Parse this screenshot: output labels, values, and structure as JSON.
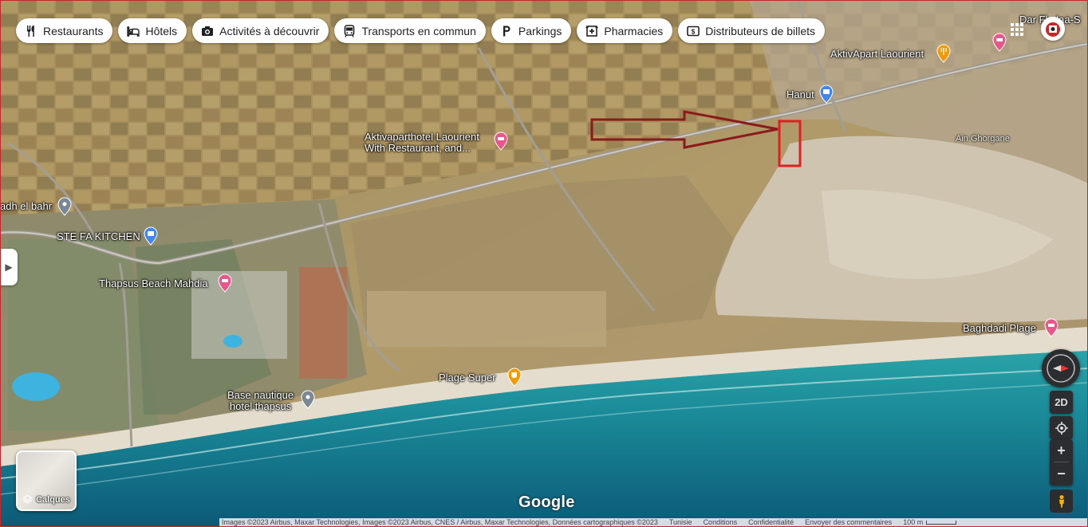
{
  "categories": [
    {
      "label": "Restaurants",
      "icon": "fork-knife-icon"
    },
    {
      "label": "Hôtels",
      "icon": "bed-icon"
    },
    {
      "label": "Activités à découvrir",
      "icon": "camera-icon"
    },
    {
      "label": "Transports en commun",
      "icon": "bus-icon"
    },
    {
      "label": "Parkings",
      "icon": "parking-icon"
    },
    {
      "label": "Pharmacies",
      "icon": "pharmacy-icon"
    },
    {
      "label": "Distributeurs de billets",
      "icon": "cash-icon"
    }
  ],
  "places": {
    "top_right": "Dar Fl...laa-S",
    "aktivapart": "AktivApart Laourient",
    "hanut": "Hanut",
    "hotel_line1": "Aktivaparthotel Laourient",
    "hotel_line2": "With Restaurant, and...",
    "adh_el_bahr": "adh el bahr",
    "ste_fa": "STE FA KITCHEN",
    "thapsus": "Thapsus Beach Mahdia",
    "base_line1": "Base nautique",
    "base_line2": "hotel thapsus",
    "plage_super": "Plage Super",
    "baghdadi": "Baghdadi Plage",
    "faint_label": "Ain Ghorgane"
  },
  "colors": {
    "hotel_pin": "#e8578b",
    "food_pin": "#f29900",
    "shop_pin": "#4285f4",
    "generic_pin": "#7b8794",
    "arrow": "#8b1a1a",
    "highlight_box": "#e02020"
  },
  "controls": {
    "view_mode": "2D",
    "layers_label": "Calques",
    "zoom_in": "+",
    "zoom_out": "−"
  },
  "logo": "Google",
  "footer": {
    "attribution": "Images ©2023 Airbus, Maxar Technologies, Images ©2023 Airbus, CNES / Airbus, Maxar Technologies, Données cartographiques ©2023",
    "links": [
      "Tunisie",
      "Conditions",
      "Confidentialité",
      "Envoyer des commentaires"
    ],
    "scale": "100 m"
  }
}
